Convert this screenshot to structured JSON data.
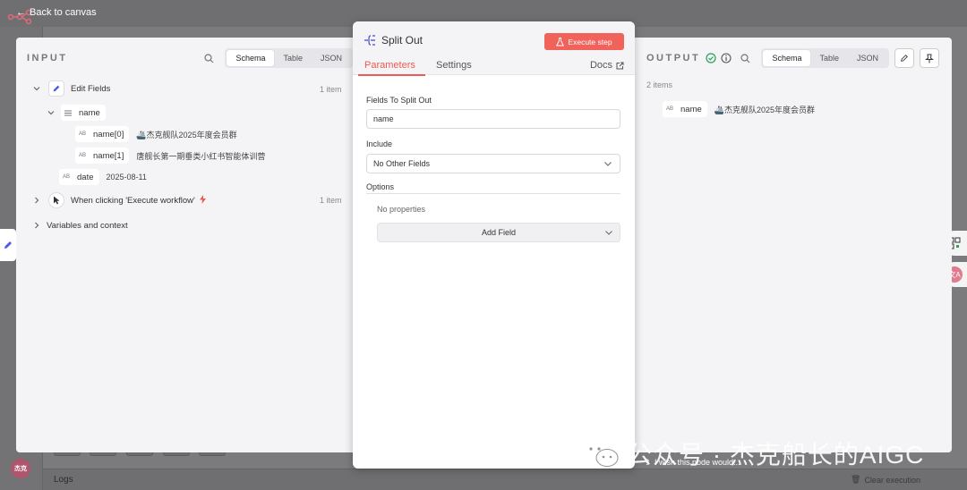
{
  "topbar": {
    "back_label": "Back to canvas"
  },
  "footer": {
    "logs_label": "Logs",
    "clear_label": "Clear execution",
    "avatar_text": "杰克"
  },
  "input": {
    "title": "INPUT",
    "tabs": [
      "Schema",
      "Table",
      "JSON"
    ],
    "active_tab": "Schema",
    "edit_fields": {
      "label": "Edit Fields",
      "count": "1 item"
    },
    "name_field": {
      "badge": "",
      "label": "name"
    },
    "name0": {
      "badge": "AB",
      "label": "name[0]",
      "value": "🚢杰克舰队2025年度会员群"
    },
    "name1": {
      "badge": "AB",
      "label": "name[1]",
      "value": "唐舰长第一期垂类小红书智能体训营"
    },
    "date": {
      "badge": "AB",
      "label": "date",
      "value": "2025-08-11"
    },
    "trigger": {
      "label": "When clicking 'Execute workflow'",
      "count": "1 item"
    },
    "vars": {
      "label": "Variables and context"
    }
  },
  "node": {
    "title": "Split Out",
    "execute_label": "Execute step",
    "tabs": {
      "parameters": "Parameters",
      "settings": "Settings",
      "docs": "Docs"
    },
    "fields_label": "Fields To Split Out",
    "fields_value": "name",
    "include_label": "Include",
    "include_value": "No Other Fields",
    "options_label": "Options",
    "no_props": "No properties",
    "add_field": "Add Field"
  },
  "output": {
    "title": "OUTPUT",
    "tabs": [
      "Schema",
      "Table",
      "JSON"
    ],
    "active_tab": "Schema",
    "items_count": "2 items",
    "name": {
      "badge": "AB",
      "label": "name",
      "value": "🚢杰克舰队2025年度会员群"
    }
  },
  "watermark": {
    "text": "公众号 · 杰克船长的AIGC",
    "wish": "I wish this node would..."
  },
  "colors": {
    "accent": "#ee5a52",
    "success": "#2aa05a"
  }
}
